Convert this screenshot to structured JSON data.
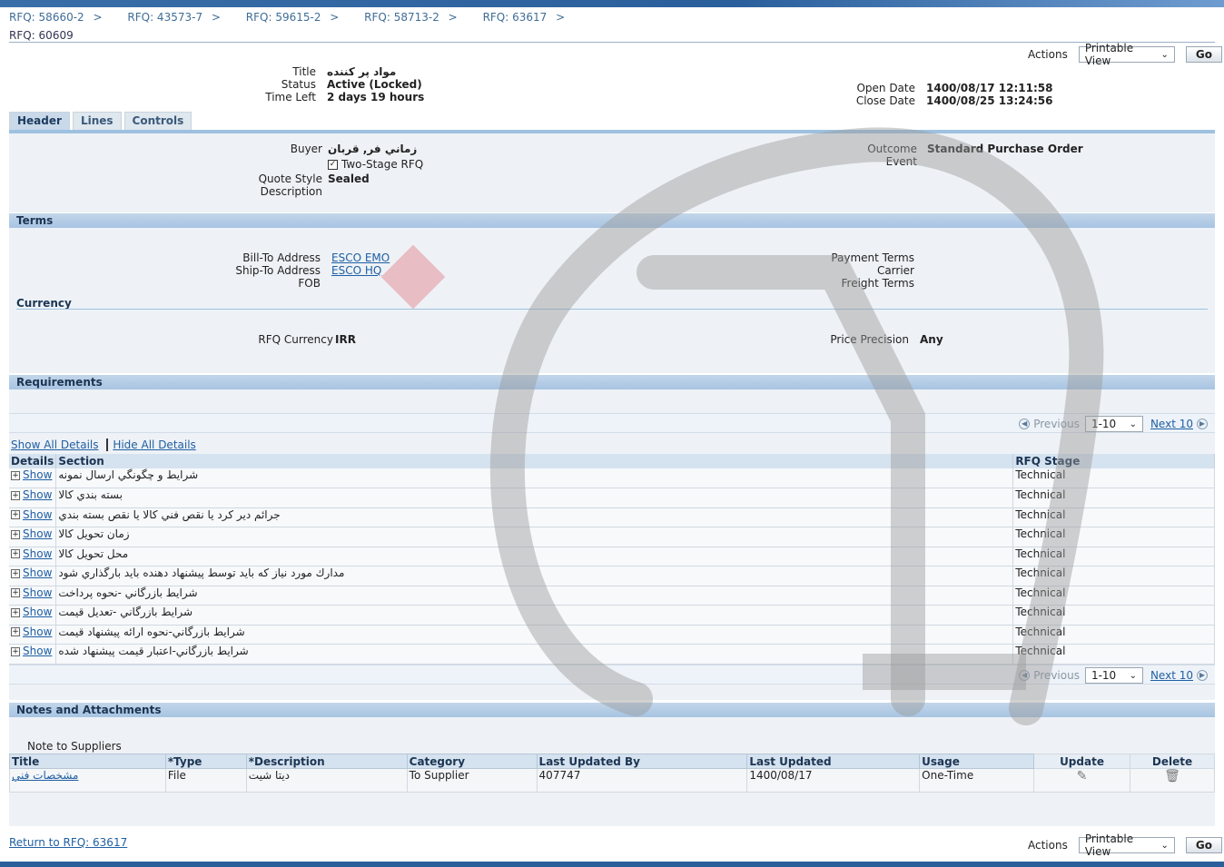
{
  "breadcrumbs": [
    "RFQ: 58660-2",
    "RFQ: 43573-7",
    "RFQ: 59615-2",
    "RFQ: 58713-2",
    "RFQ: 63617"
  ],
  "page_title": "RFQ: 60609",
  "actions": {
    "label": "Actions",
    "select_value": "Printable View",
    "go": "Go"
  },
  "summary": {
    "title_label": "Title",
    "title_value": "مواد پر کننده",
    "status_label": "Status",
    "status_value": "Active (Locked)",
    "time_left_label": "Time Left",
    "time_left_value": "2 days 19 hours",
    "open_date_label": "Open Date",
    "open_date_value": "1400/08/17 12:11:58",
    "close_date_label": "Close Date",
    "close_date_value": "1400/08/25 13:24:56"
  },
  "tabs": [
    "Header",
    "Lines",
    "Controls"
  ],
  "header": {
    "buyer_label": "Buyer",
    "buyer_value": "زماني فر, قربان",
    "two_stage_label": "Two-Stage RFQ",
    "quote_style_label": "Quote Style",
    "quote_style_value": "Sealed",
    "description_label": "Description",
    "outcome_label": "Outcome",
    "outcome_value": "Standard Purchase Order",
    "event_label": "Event"
  },
  "terms": {
    "heading": "Terms",
    "bill_to_label": "Bill-To Address",
    "bill_to_value": "ESCO EMO",
    "ship_to_label": "Ship-To Address",
    "ship_to_value": "ESCO HQ",
    "fob_label": "FOB",
    "payment_terms_label": "Payment Terms",
    "carrier_label": "Carrier",
    "freight_terms_label": "Freight Terms",
    "currency_heading": "Currency",
    "rfq_currency_label": "RFQ Currency",
    "rfq_currency_value": "IRR",
    "price_precision_label": "Price Precision",
    "price_precision_value": "Any"
  },
  "requirements": {
    "heading": "Requirements",
    "pager": {
      "previous": "Previous",
      "range": "1-10",
      "next": "Next 10"
    },
    "show_all": "Show All Details",
    "hide_all": "Hide All Details",
    "columns": [
      "Details",
      "Section",
      "RFQ Stage"
    ],
    "show_label": "Show",
    "rows": [
      {
        "section": "شرايط و چگونگي ارسال نمونه",
        "stage": "Technical"
      },
      {
        "section": "بسته بندي كالا",
        "stage": "Technical"
      },
      {
        "section": "جرائم دير كرد يا نقص فني كالا يا نقص بسته بندي",
        "stage": "Technical"
      },
      {
        "section": "زمان تحويل كالا",
        "stage": "Technical"
      },
      {
        "section": "محل تحويل كالا",
        "stage": "Technical"
      },
      {
        "section": "مدارك مورد نياز كه بايد توسط پيشنهاد دهنده بايد بارگذاري شود",
        "stage": "Technical"
      },
      {
        "section": "شرايط بازرگاني -نحوه پرداخت",
        "stage": "Technical"
      },
      {
        "section": "شرايط بازرگاني -تعديل قيمت",
        "stage": "Technical"
      },
      {
        "section": "شرايط بازرگاني-نحوه ارائه پيشنهاد قيمت",
        "stage": "Technical"
      },
      {
        "section": "شرايط بازرگاني-اعتبار قيمت پيشنهاد شده",
        "stage": "Technical"
      }
    ]
  },
  "notes": {
    "heading": "Notes and Attachments",
    "note_label": "Note to Suppliers",
    "columns": [
      "Title",
      "*Type",
      "*Description",
      "Category",
      "Last Updated By",
      "Last Updated",
      "Usage",
      "Update",
      "Delete"
    ],
    "rows": [
      {
        "title": "مشخصات فني",
        "type": "File",
        "description": "ديتا شيت",
        "category": "To Supplier",
        "updated_by": "407747",
        "updated": "1400/08/17",
        "usage": "One-Time"
      }
    ]
  },
  "return_link": "Return to RFQ: 63617"
}
